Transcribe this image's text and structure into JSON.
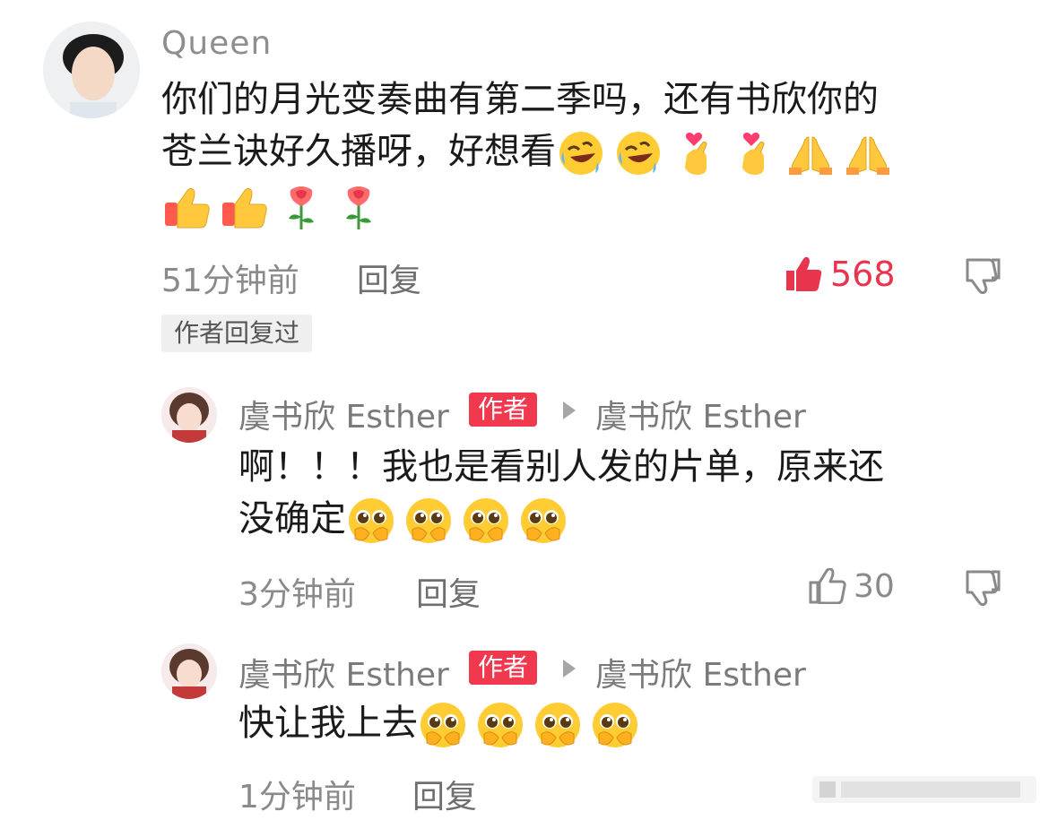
{
  "main_comment": {
    "username": "Queen",
    "text_line1": "你们的月光变奏曲有第二季吗，还有书欣你的",
    "text_line2": "苍兰诀好久播呀，好想看",
    "emojis_line2": [
      "rofl-face",
      "rofl-face",
      "finger-heart",
      "finger-heart",
      "folded-hands",
      "folded-hands"
    ],
    "emojis_line3": [
      "thumbs-up",
      "thumbs-up",
      "rose",
      "rose"
    ],
    "time": "51分钟前",
    "reply_label": "回复",
    "likes": "568",
    "author_replied_tag": "作者回复过"
  },
  "replies": [
    {
      "name": "虞书欣 Esther",
      "badge": "作者",
      "reply_to": "虞书欣 Esther",
      "text_line1": "啊！！！我也是看别人发的片单，原来还",
      "text_line2": "没确定",
      "emojis": [
        "pleading-face",
        "pleading-face",
        "pleading-face",
        "pleading-face"
      ],
      "time": "3分钟前",
      "reply_label": "回复",
      "likes": "30"
    },
    {
      "name": "虞书欣 Esther",
      "badge": "作者",
      "reply_to": "虞书欣 Esther",
      "text_line1": "快让我上去",
      "emojis": [
        "pleading-face",
        "pleading-face",
        "pleading-face",
        "pleading-face"
      ],
      "time": "1分钟前",
      "reply_label": "回复"
    }
  ],
  "colors": {
    "liked_red": "#e8344d",
    "badge_red": "#f0384f",
    "meta_gray": "#8a8a8a"
  }
}
